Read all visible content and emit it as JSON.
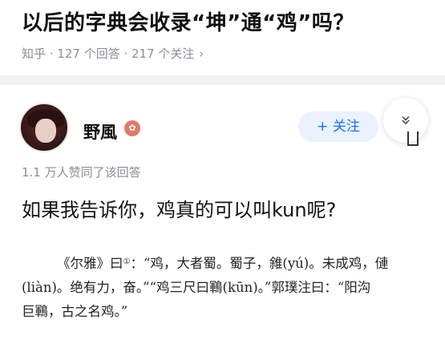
{
  "question": {
    "title": "以后的字典会收录“坤”通“鸡”吗？",
    "meta": "知乎 · 127 个回答 · 217 个关注",
    "chevron": "›"
  },
  "answer": {
    "author": "野風",
    "follow_label": "+ 关注",
    "collapse_icon": "»",
    "upvotes": "1.1 万人赞同了该回答",
    "text": "如果我告诉你，鸡真的可以叫kun呢?",
    "quote": {
      "line1_a": "《尔雅》曰",
      "footnote": "①",
      "line1_b": "：“鸡，大者蜀。蜀子，雓(yú)。未成鸡，僆",
      "line2": "(liàn)。绝有力，奋。”“鸡三尺曰鶤(kūn)。”郭璞注曰：“阳沟",
      "line3": "巨鶤，古之名鸡。”"
    }
  },
  "colors": {
    "accent": "#1772f6",
    "follow_bg": "#e9f2fd",
    "meta_gray": "#8a8f99",
    "divider": "#f0f1f3"
  }
}
